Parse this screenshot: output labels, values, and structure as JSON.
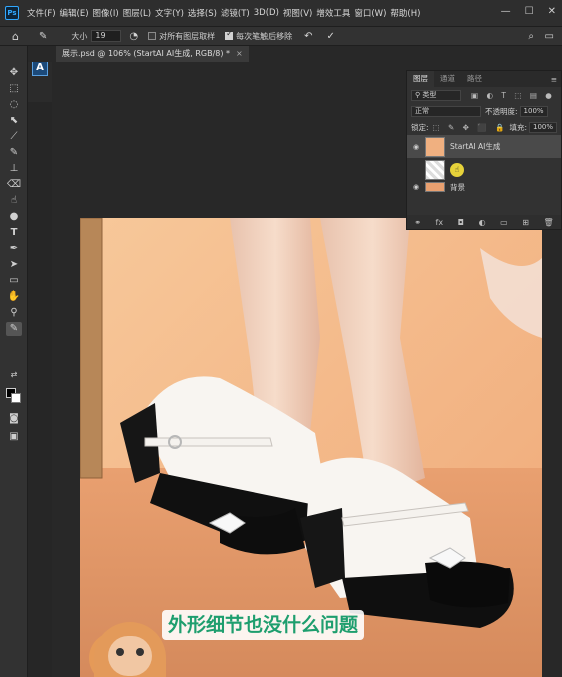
{
  "menubar": {
    "logo": "Ps",
    "items": [
      "文件(F)",
      "编辑(E)",
      "图像(I)",
      "图层(L)",
      "文字(Y)",
      "选择(S)",
      "滤镜(T)",
      "3D(D)",
      "视图(V)",
      "增效工具",
      "窗口(W)",
      "帮助(H)"
    ]
  },
  "options": {
    "size_label": "大小",
    "size_value": "19",
    "sample_all_label": "对所有图层取样",
    "remove_after_label": "每次笔触后移除"
  },
  "document": {
    "tab_title": "展示.psd @ 106% (StartAI AI生成, RGB/8) *"
  },
  "plugin": {
    "badge": "A"
  },
  "layers_panel": {
    "tabs": [
      "图层",
      "通道",
      "路径"
    ],
    "filter_kind": "类型",
    "blend_mode": "正常",
    "opacity_label": "不透明度:",
    "opacity_value": "100%",
    "lock_label": "锁定:",
    "fill_label": "填充:",
    "fill_value": "100%",
    "layers": [
      {
        "name": "StartAI AI生成",
        "visible": true,
        "selected": true
      },
      {
        "name": "",
        "visible": false,
        "selected": false
      },
      {
        "name": "背景",
        "visible": true,
        "selected": false
      }
    ]
  },
  "subtitle": "外形细节也没什么问题",
  "colors": {
    "accent": "#31a8ff",
    "subtitle_text": "#1e9e6e",
    "background_wall": "#f2b886"
  }
}
